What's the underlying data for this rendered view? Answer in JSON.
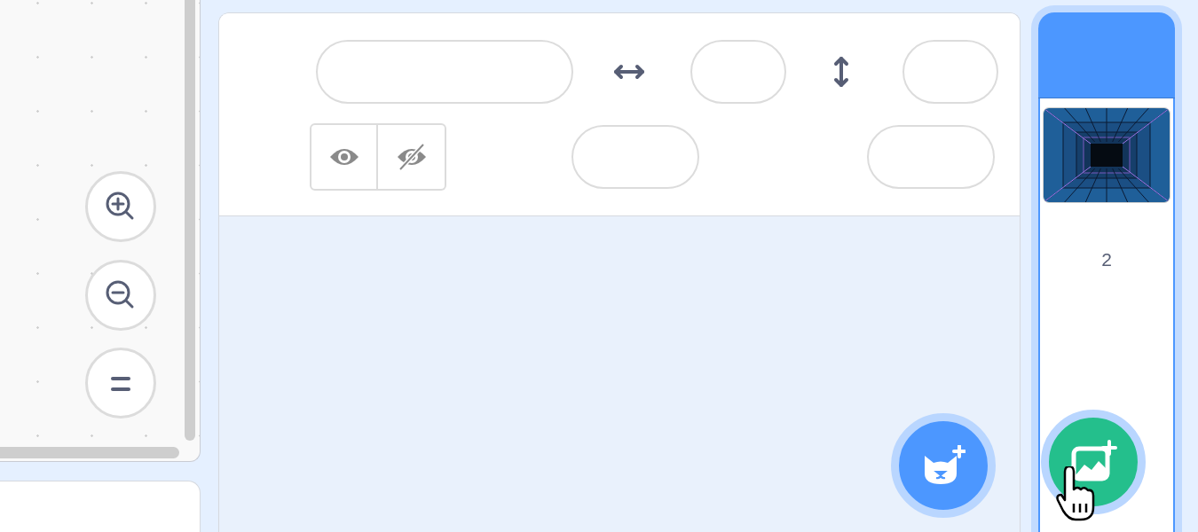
{
  "sprite_info": {
    "visibility": [
      {
        "kind": "show",
        "selected": false
      },
      {
        "kind": "hide",
        "selected": false
      }
    ]
  },
  "stage": {
    "backdrop_count": "2"
  }
}
